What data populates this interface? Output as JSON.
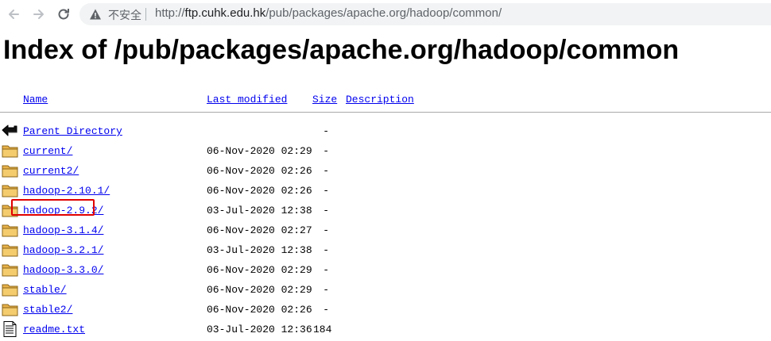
{
  "browser": {
    "security_label": "不安全",
    "url_scheme": "http://",
    "url_host": "ftp.cuhk.edu.hk",
    "url_path": "/pub/packages/apache.org/hadoop/common/"
  },
  "page": {
    "title": "Index of /pub/packages/apache.org/hadoop/common"
  },
  "table": {
    "headers": {
      "name": "Name",
      "last_modified": "Last modified",
      "size": "Size",
      "description": "Description"
    },
    "rows": [
      {
        "name": "Parent Directory",
        "date": "",
        "size": "-",
        "icon": "back-arrow-icon"
      },
      {
        "name": "current/",
        "date": "06-Nov-2020 02:29",
        "size": "-",
        "icon": "folder-icon"
      },
      {
        "name": "current2/",
        "date": "06-Nov-2020 02:26",
        "size": "-",
        "icon": "folder-icon"
      },
      {
        "name": "hadoop-2.10.1/",
        "date": "06-Nov-2020 02:26",
        "size": "-",
        "icon": "folder-icon"
      },
      {
        "name": "hadoop-2.9.2/",
        "date": "03-Jul-2020 12:38",
        "size": "-",
        "icon": "folder-icon"
      },
      {
        "name": "hadoop-3.1.4/",
        "date": "06-Nov-2020 02:27",
        "size": "-",
        "icon": "folder-icon"
      },
      {
        "name": "hadoop-3.2.1/",
        "date": "03-Jul-2020 12:38",
        "size": "-",
        "icon": "folder-icon"
      },
      {
        "name": "hadoop-3.3.0/",
        "date": "06-Nov-2020 02:29",
        "size": "-",
        "icon": "folder-icon"
      },
      {
        "name": "stable/",
        "date": "06-Nov-2020 02:29",
        "size": "-",
        "icon": "folder-icon"
      },
      {
        "name": "stable2/",
        "date": "06-Nov-2020 02:26",
        "size": "-",
        "icon": "folder-icon"
      },
      {
        "name": "readme.txt",
        "date": "03-Jul-2020 12:36",
        "size": "184",
        "icon": "text-file-icon"
      }
    ]
  },
  "colors": {
    "link": "#0000ee",
    "highlight": "#e00000",
    "folder": "#e8b24a"
  }
}
